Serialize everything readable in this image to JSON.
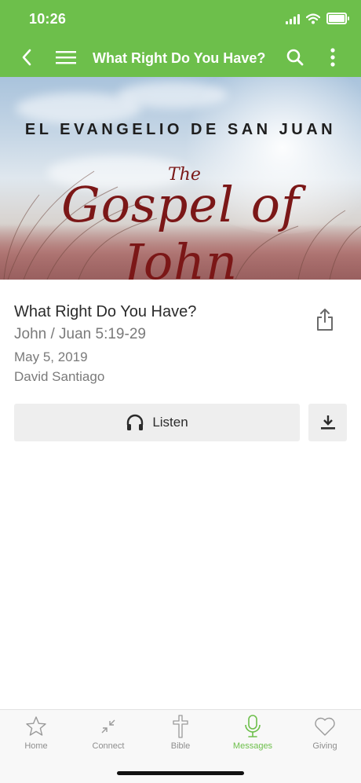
{
  "status": {
    "time": "10:26"
  },
  "appbar": {
    "title": "What Right Do You Have?"
  },
  "hero": {
    "subtitle": "EL EVANGELIO DE SAN JUAN",
    "the": "The",
    "title": "Gospel of John"
  },
  "message": {
    "title": "What Right Do You Have?",
    "reference": "John / Juan 5:19-29",
    "date": "May 5, 2019",
    "speaker": "David Santiago"
  },
  "actions": {
    "listen_label": "Listen"
  },
  "tabs": [
    {
      "label": "Home",
      "icon": "star-icon",
      "active": false
    },
    {
      "label": "Connect",
      "icon": "connect-icon",
      "active": false
    },
    {
      "label": "Bible",
      "icon": "cross-icon",
      "active": false
    },
    {
      "label": "Messages",
      "icon": "microphone-icon",
      "active": true
    },
    {
      "label": "Giving",
      "icon": "heart-icon",
      "active": false
    }
  ],
  "colors": {
    "accent": "#6dbf4b",
    "hero_title": "#7b1717",
    "tab_inactive": "#8e8e8e"
  }
}
